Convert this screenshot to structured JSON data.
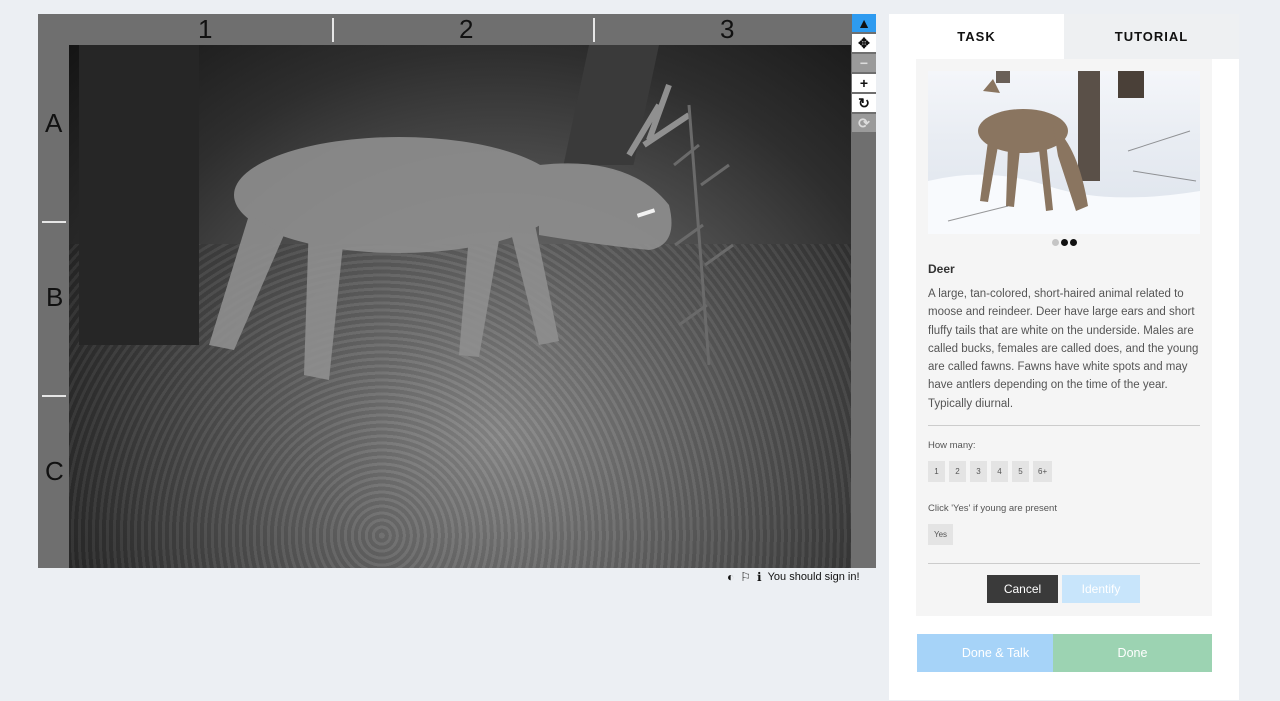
{
  "viewer": {
    "columns": [
      "1",
      "2",
      "3"
    ],
    "rows": [
      "A",
      "B",
      "C"
    ],
    "tools": [
      {
        "name": "pointer-icon",
        "glyph": "▲",
        "active": true
      },
      {
        "name": "move-icon",
        "glyph": "✥"
      },
      {
        "name": "zoom-out-icon",
        "glyph": "−",
        "disabled": true
      },
      {
        "name": "zoom-in-icon",
        "glyph": "+"
      },
      {
        "name": "rotate-icon",
        "glyph": "↻"
      },
      {
        "name": "reset-icon",
        "glyph": "⟳",
        "disabled": true
      }
    ],
    "meta": {
      "contrast_icon": "◐",
      "flag_icon": "⚐",
      "info_icon": "ℹ",
      "sign_in_text": "You should sign in!"
    }
  },
  "panel": {
    "tabs": [
      "TASK",
      "TUTORIAL"
    ],
    "choice": {
      "name": "Deer",
      "description": "A large, tan-colored, short-haired animal related to moose and reindeer. Deer have large ears and short fluffy tails that are white on the underside. Males are called bucks, females are called does, and the young are called fawns. Fawns have white spots and may have antlers depending on the time of the year. Typically diurnal.",
      "image_dots": 3,
      "active_dots": [
        1,
        2
      ]
    },
    "how_many": {
      "label": "How many:",
      "options": [
        "1",
        "2",
        "3",
        "4",
        "5",
        "6+"
      ]
    },
    "young": {
      "label": "Click 'Yes' if young are present",
      "option": "Yes"
    },
    "cancel_label": "Cancel",
    "identify_label": "Identify",
    "done_talk_label": "Done & Talk",
    "done_label": "Done"
  }
}
